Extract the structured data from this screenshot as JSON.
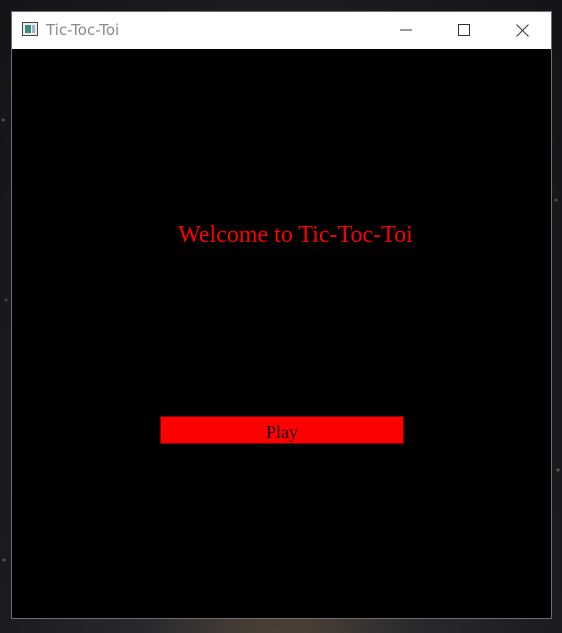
{
  "window": {
    "title": "Tic-Toc-Toi",
    "controls": {
      "minimize_icon": "minimize-icon",
      "maximize_icon": "maximize-icon",
      "close_icon": "close-icon"
    }
  },
  "main": {
    "welcome_text": "Welcome to Tic-Toc-Toi",
    "play_label": "Play"
  },
  "colors": {
    "background": "#000000",
    "accent": "#ff0000",
    "titlebar": "#ffffff"
  }
}
